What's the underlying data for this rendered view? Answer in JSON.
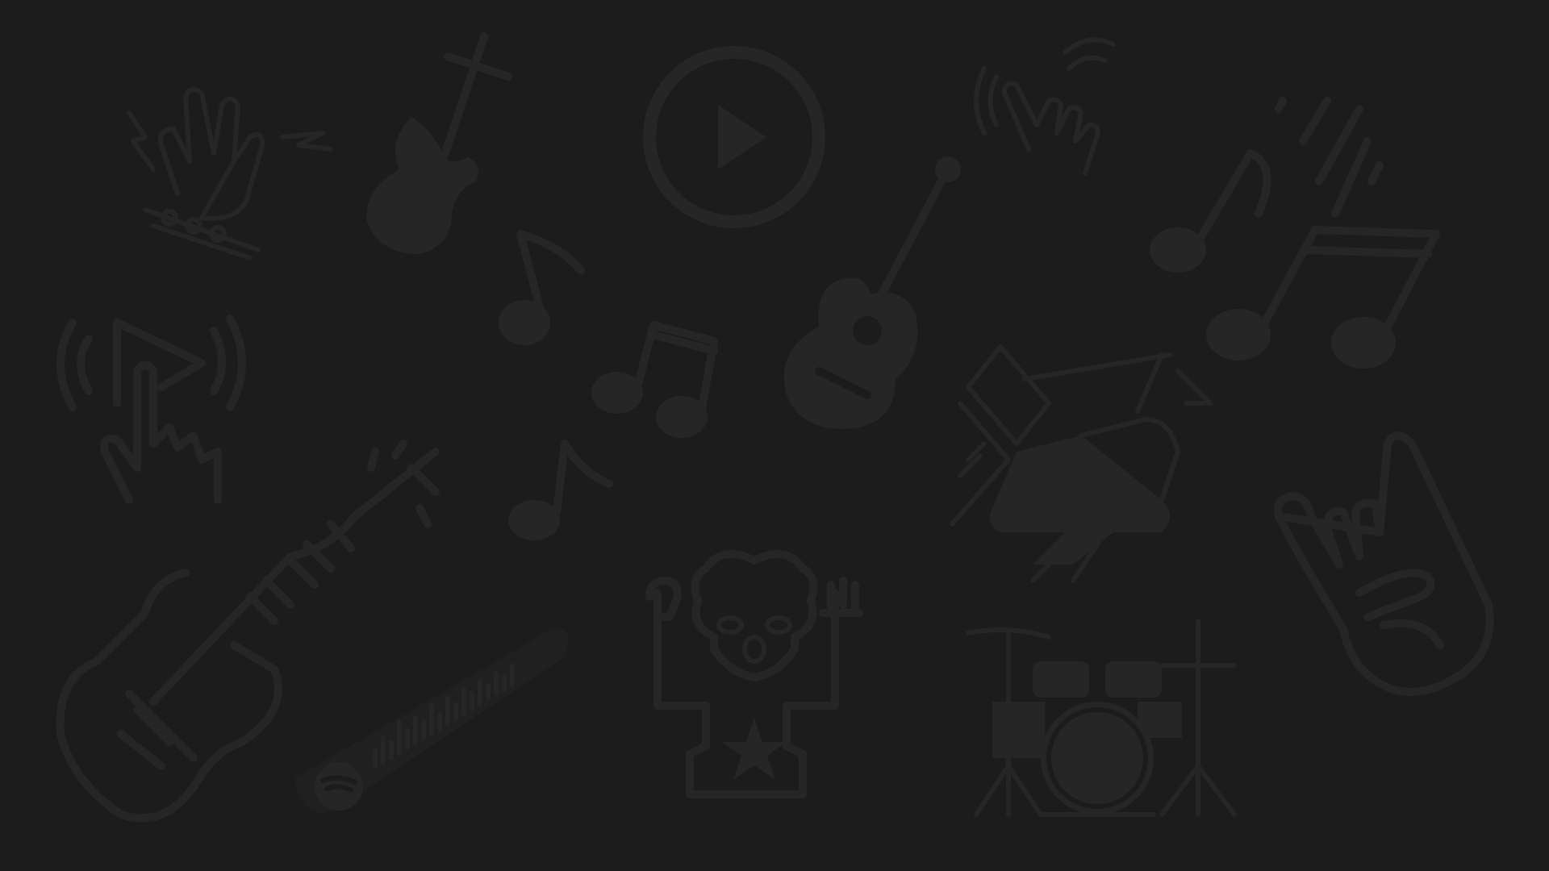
{
  "wallpaper": {
    "theme": "music doodle pattern",
    "background_color": "#1c1c1c",
    "icon_color": "#262626",
    "icons": [
      "rock-hand-with-lightning-icon",
      "electric-guitar-icon",
      "play-button-icon",
      "tap-hand-with-signal-icon",
      "music-notes-icon",
      "touch-play-icon",
      "eighth-note-icon",
      "beamed-notes-icon",
      "acoustic-guitar-icon",
      "grand-piano-icon",
      "rock-horns-hand-icon",
      "bass-guitar-icon",
      "spotify-soundwave-icon",
      "rock-singer-icon",
      "drum-kit-icon"
    ]
  }
}
